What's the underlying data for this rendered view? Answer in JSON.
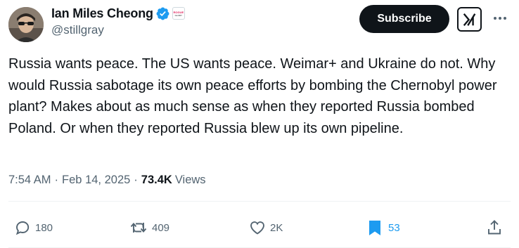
{
  "author": {
    "display_name": "Ian Miles Cheong",
    "handle": "@stillgray",
    "affiliation_badge": "ROGUE GLORY",
    "verified_icon": "verified-badge-icon"
  },
  "header": {
    "subscribe_label": "Subscribe",
    "grok_icon": "grok-icon",
    "more_icon": "more-icon"
  },
  "tweet": {
    "text": "Russia wants peace. The US wants peace. Weimar+ and Ukraine do not. Why would Russia sabotage its own peace efforts by bombing the Chernobyl power plant? Makes about as much sense as when they reported Russia bombed Poland. Or when they reported Russia blew up its own pipeline.",
    "time": "7:54 AM",
    "separator": "·",
    "date": "Feb 14, 2025",
    "views_count": "73.4K",
    "views_label": "Views"
  },
  "actions": {
    "reply_count": "180",
    "repost_count": "409",
    "like_count": "2K",
    "bookmark_count": "53"
  },
  "colors": {
    "accent": "#1d9bf0",
    "text": "#0f1419",
    "muted": "#536471"
  }
}
